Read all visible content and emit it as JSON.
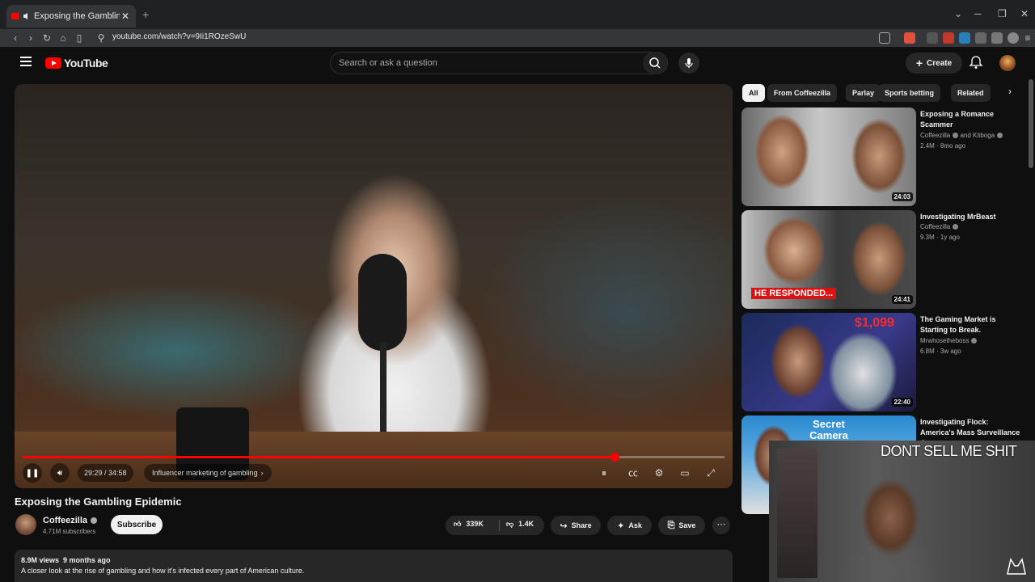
{
  "browser": {
    "tab_title": "Exposing the Gambling Epide",
    "new_tab": "+",
    "close_tab": "✕",
    "url": "youtube.com/watch?v=9Ii1ROzeSwU"
  },
  "header": {
    "logo_text": "YouTube",
    "search_placeholder": "Search or ask a question",
    "create_label": "Create"
  },
  "player": {
    "current_time": "29:29",
    "duration": "34:58",
    "time_display": "29:29 / 34:58",
    "chapter": "Influencer marketing of gambling",
    "progress_fraction": 0.843
  },
  "video": {
    "title": "Exposing the Gambling Epidemic",
    "channel": "Coffeezilla",
    "subscribers": "4.71M subscribers",
    "subscribe_label": "Subscribe",
    "likes": "339K",
    "dislikes": "1.4K",
    "share_label": "Share",
    "ask_label": "Ask",
    "save_label": "Save",
    "views": "8.9M views",
    "age": "9 months ago",
    "description": "A closer look at the rise of gambling and how it's infected every part of American culture."
  },
  "chips": [
    "All",
    "From Coffeezilla",
    "Parlay",
    "Sports betting",
    "Related"
  ],
  "recommendations": [
    {
      "title": "Exposing a Romance Scammer",
      "channel": "Coffeezilla",
      "channel_extra": "and Kitboga",
      "views": "2.4M",
      "age": "8mo ago",
      "duration": "24:03"
    },
    {
      "title": "Investigating MrBeast",
      "channel": "Coffeezilla",
      "channel_extra": "",
      "views": "9.3M",
      "age": "1y ago",
      "duration": "24:41",
      "thumb_text": "HE RESPONDED..."
    },
    {
      "title": "The Gaming Market is Starting to Break.",
      "channel": "Mrwhosetheboss",
      "channel_extra": "",
      "views": "6.8M",
      "age": "3w ago",
      "duration": "22:40",
      "thumb_text": "$1,099"
    },
    {
      "title": "Investigating Flock: America's Mass Surveillance Company",
      "channel": "",
      "channel_extra": "",
      "views": "",
      "age": "",
      "duration": "",
      "thumb_text": "Secret Camera"
    }
  ],
  "overlay": {
    "caption": "DONT SELL ME SHIT"
  },
  "colors": {
    "accent": "#ff0000",
    "background": "#0f0f0f",
    "chip_bg": "#272727"
  }
}
